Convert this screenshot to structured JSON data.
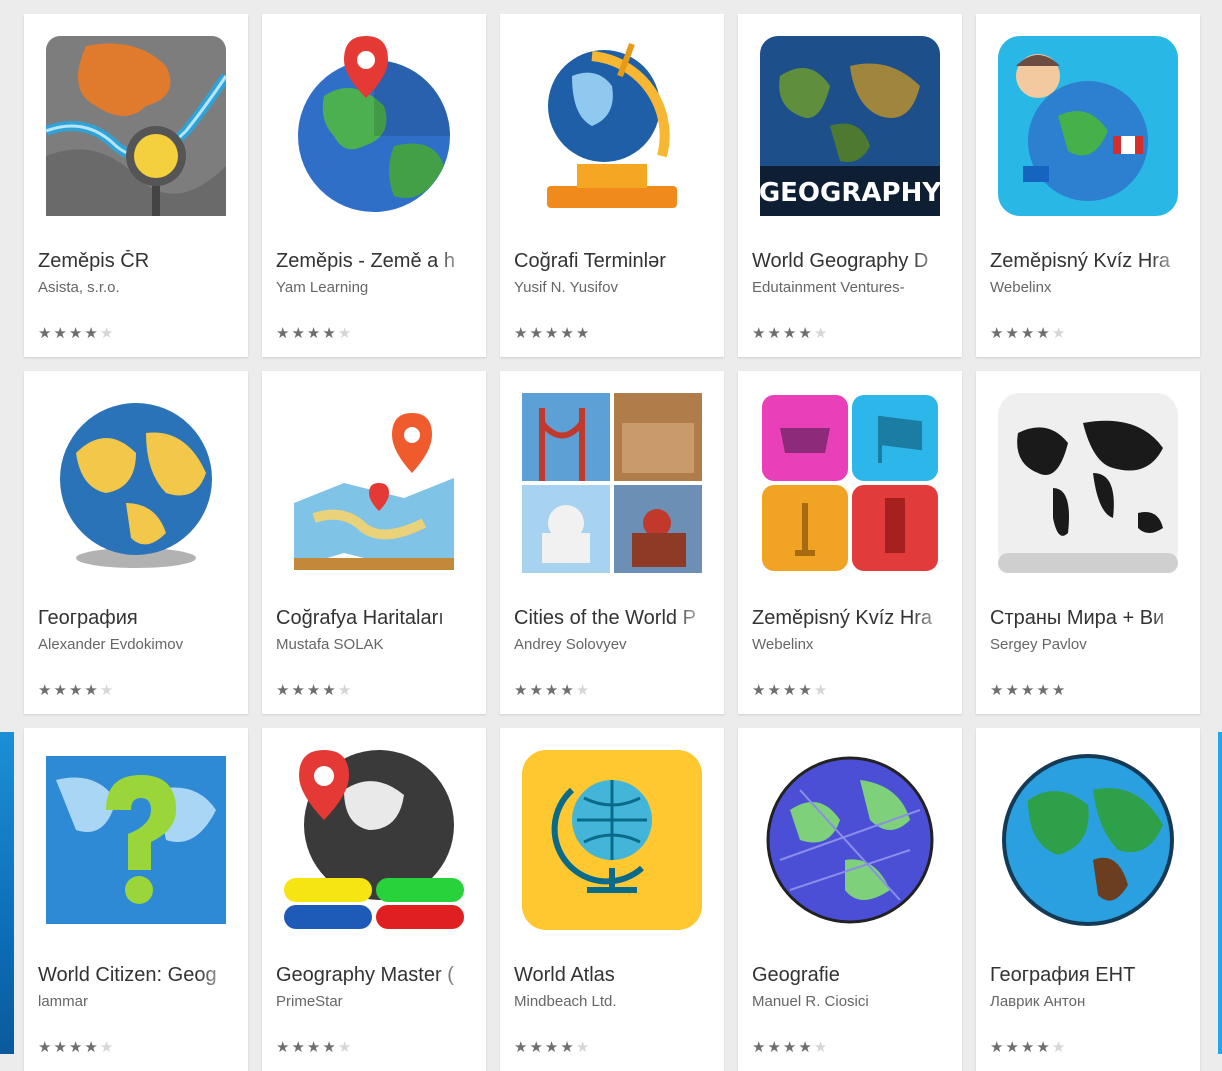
{
  "apps": [
    {
      "title": "Zeměpis ČR",
      "developer": "Asista, s.r.o.",
      "rating": 4,
      "icon": "czech-map-icon"
    },
    {
      "title": "Zeměpis - Země a h",
      "developer": "Yam Learning",
      "rating": 4,
      "icon": "globe-pin-icon"
    },
    {
      "title": "Coğrafi Terminlər",
      "developer": "Yusif N. Yusifov",
      "rating": 4.5,
      "icon": "desk-globe-icon"
    },
    {
      "title": "World Geography D",
      "developer": "Edutainment Ventures-",
      "rating": 4,
      "icon": "geography-map-icon"
    },
    {
      "title": "Zeměpisný Kvíz Hra",
      "developer": "Webelinx",
      "rating": 4,
      "icon": "kid-globe-flags-icon"
    },
    {
      "title": "География",
      "developer": "Alexander Evdokimov",
      "rating": 4,
      "icon": "blue-globe-icon"
    },
    {
      "title": "Coğrafya Haritaları",
      "developer": "Mustafa SOLAK",
      "rating": 4,
      "icon": "map-pins-icon"
    },
    {
      "title": "Cities of the World P",
      "developer": "Andrey Solovyev",
      "rating": 4,
      "icon": "landmarks-collage-icon"
    },
    {
      "title": "Zeměpisný Kvíz Hra",
      "developer": "Webelinx",
      "rating": 4,
      "icon": "quiz-tiles-icon"
    },
    {
      "title": "Страны Мира + Ви",
      "developer": "Sergey Pavlov",
      "rating": 4.5,
      "icon": "world-map-tile-icon"
    },
    {
      "title": "World Citizen: Geog",
      "developer": "lammar",
      "rating": 4,
      "icon": "question-map-icon"
    },
    {
      "title": "Geography Master (",
      "developer": "PrimeStar",
      "rating": 4,
      "icon": "dark-globe-pin-icon"
    },
    {
      "title": "World Atlas",
      "developer": "Mindbeach Ltd.",
      "rating": 4,
      "icon": "atlas-globe-icon"
    },
    {
      "title": "Geografie",
      "developer": "Manuel R. Ciosici",
      "rating": 4,
      "icon": "scribble-globe-icon"
    },
    {
      "title": "География ЕНТ",
      "developer": "Лаврик Антон",
      "rating": 4,
      "icon": "green-globe-icon"
    }
  ],
  "colors": {
    "card": "#ffffff",
    "background": "#ececec",
    "title": "#333333",
    "developer": "#666666",
    "star": "#6e6e6e"
  }
}
